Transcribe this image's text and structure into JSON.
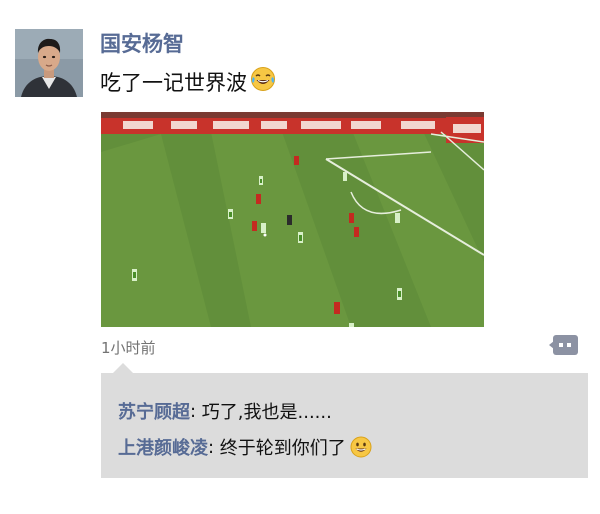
{
  "post": {
    "author_name": "国安杨智",
    "text": "吃了一记世界波",
    "text_emoji": "tears-of-joy-emoji",
    "media_type": "football-match-gif",
    "timestamp": "1小时前",
    "comment_button_icon": "comment-dots-icon"
  },
  "comments": [
    {
      "name": "苏宁顾超",
      "separator": ": ",
      "text": "巧了,我也是......",
      "emoji": ""
    },
    {
      "name": "上港颜峻凌",
      "separator": ": ",
      "text": "终于轮到你们了",
      "emoji": "smile-emoji"
    }
  ],
  "colors": {
    "name_blue": "#576b95",
    "text": "#111111",
    "muted": "#737373",
    "comment_bg": "#dcdcdc",
    "pitch_green": "#5e8a3a",
    "comment_icon": "#8c92a3"
  }
}
